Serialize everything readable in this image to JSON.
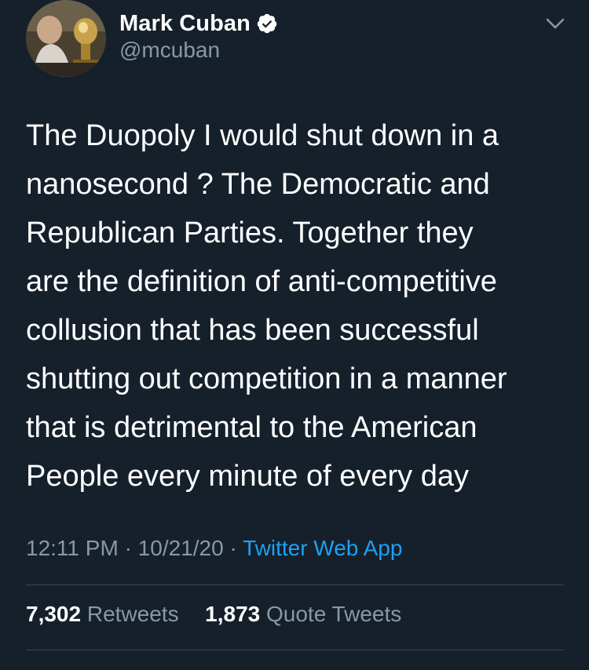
{
  "tweet": {
    "author": {
      "display_name": "Mark Cuban",
      "handle": "@mcuban",
      "verified": true,
      "avatar_icon": "profile-photo"
    },
    "text": "The Duopoly I would shut down in a\nnanosecond ? The Democratic and\nRepublican Parties. Together they\nare the definition of anti-competitive\ncollusion that has been successful\nshutting out competition in a manner\nthat is detrimental to the American\nPeople every minute of every day",
    "time": "12:11 PM",
    "separator": "·",
    "date": "10/21/20",
    "source": "Twitter Web App",
    "stats": {
      "retweets_count": "7,302",
      "retweets_label": "Retweets",
      "quote_count": "1,873",
      "quote_label": "Quote Tweets"
    }
  },
  "colors": {
    "background": "#15202b",
    "text_primary": "#ffffff",
    "text_secondary": "#8899a6",
    "accent": "#1da1f2",
    "divider": "#38444d"
  }
}
